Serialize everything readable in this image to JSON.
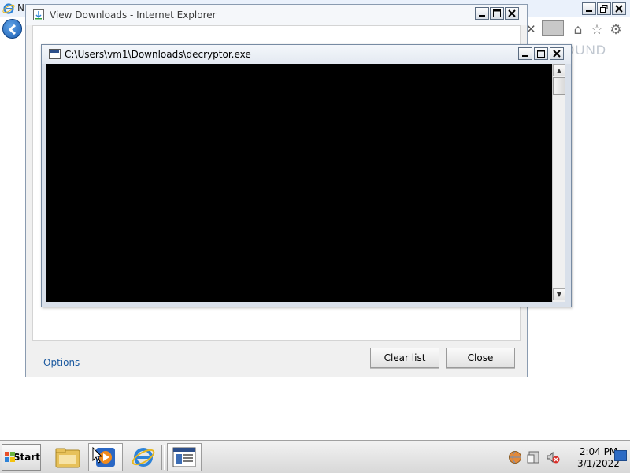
{
  "background_browser": {
    "title_fragment": "N",
    "sound_text": "OUND"
  },
  "downloads_dialog": {
    "title": "View Downloads - Internet Explorer",
    "options_label": "Options",
    "clear_list_label": "Clear list",
    "close_label": "Close"
  },
  "console_window": {
    "title": "C:\\Users\\vm1\\Downloads\\decryptor.exe",
    "background_color": "#000000"
  },
  "taskbar": {
    "start_label": "Start",
    "time": "2:04 PM",
    "date": "3/1/2022",
    "pinned": [
      "file-explorer-icon",
      "media-player-icon",
      "internet-explorer-icon",
      "console-app-icon"
    ]
  },
  "colors": {
    "link": "#1c5aa0",
    "ie_blue": "#1a5fb4"
  }
}
